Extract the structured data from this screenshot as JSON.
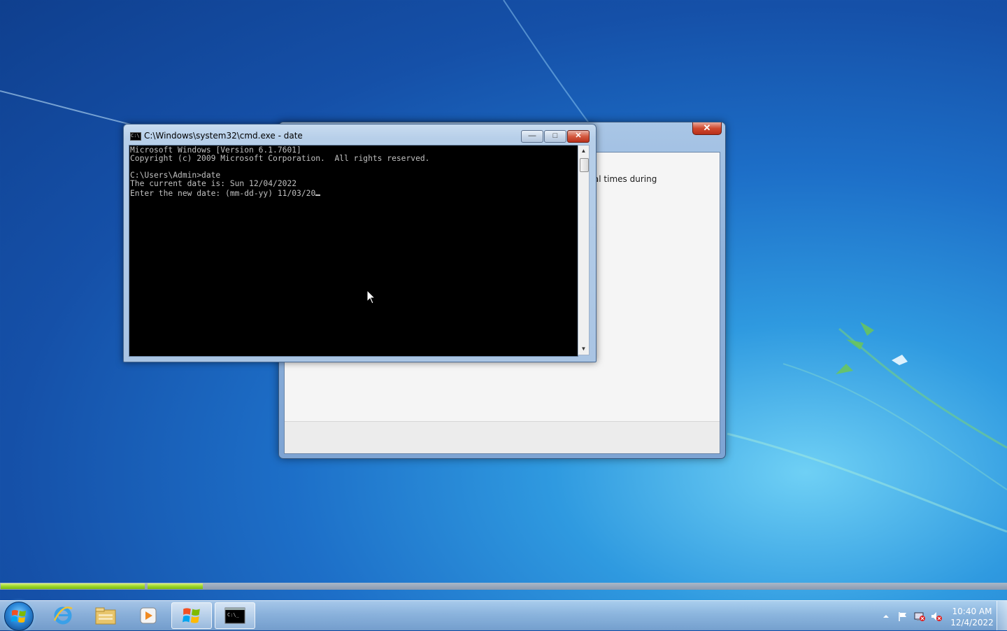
{
  "desktop": {
    "background_window": {
      "snippet_text": "ral times during",
      "close_label": "✕"
    },
    "cmd_window": {
      "title": "C:\\Windows\\system32\\cmd.exe - date",
      "icon_text": "C:\\",
      "minimize_label": "—",
      "maximize_label": "□",
      "close_label": "✕",
      "console_lines": [
        "Microsoft Windows [Version 6.1.7601]",
        "Copyright (c) 2009 Microsoft Corporation.  All rights reserved.",
        "",
        "C:\\Users\\Admin>date",
        "The current date is: Sun 12/04/2022",
        "Enter the new date: (mm-dd-yy) 11/03/20"
      ],
      "scroll_up": "▲",
      "scroll_down": "▼"
    },
    "progress": {
      "bar1_fraction": 1.0,
      "bar2_fraction": 0.27
    }
  },
  "taskbar": {
    "items": [
      {
        "name": "internet-explorer",
        "icon": "ie-icon"
      },
      {
        "name": "windows-explorer",
        "icon": "folder-icon"
      },
      {
        "name": "media-player",
        "icon": "media-player-icon"
      },
      {
        "name": "windows-logo-app",
        "icon": "windows-flag-icon"
      },
      {
        "name": "command-prompt",
        "icon": "cmd-icon",
        "active": true
      }
    ],
    "clock": {
      "time": "10:40 AM",
      "date": "12/4/2022"
    },
    "tray_icons": [
      "show-hidden-icons",
      "action-center-flag-icon",
      "network-icon",
      "volume-muted-icon"
    ]
  },
  "colors": {
    "console_bg": "#000000",
    "console_fg": "#c0c0c0",
    "progress_green": "#9cd62a",
    "close_red": "#d0492e"
  }
}
